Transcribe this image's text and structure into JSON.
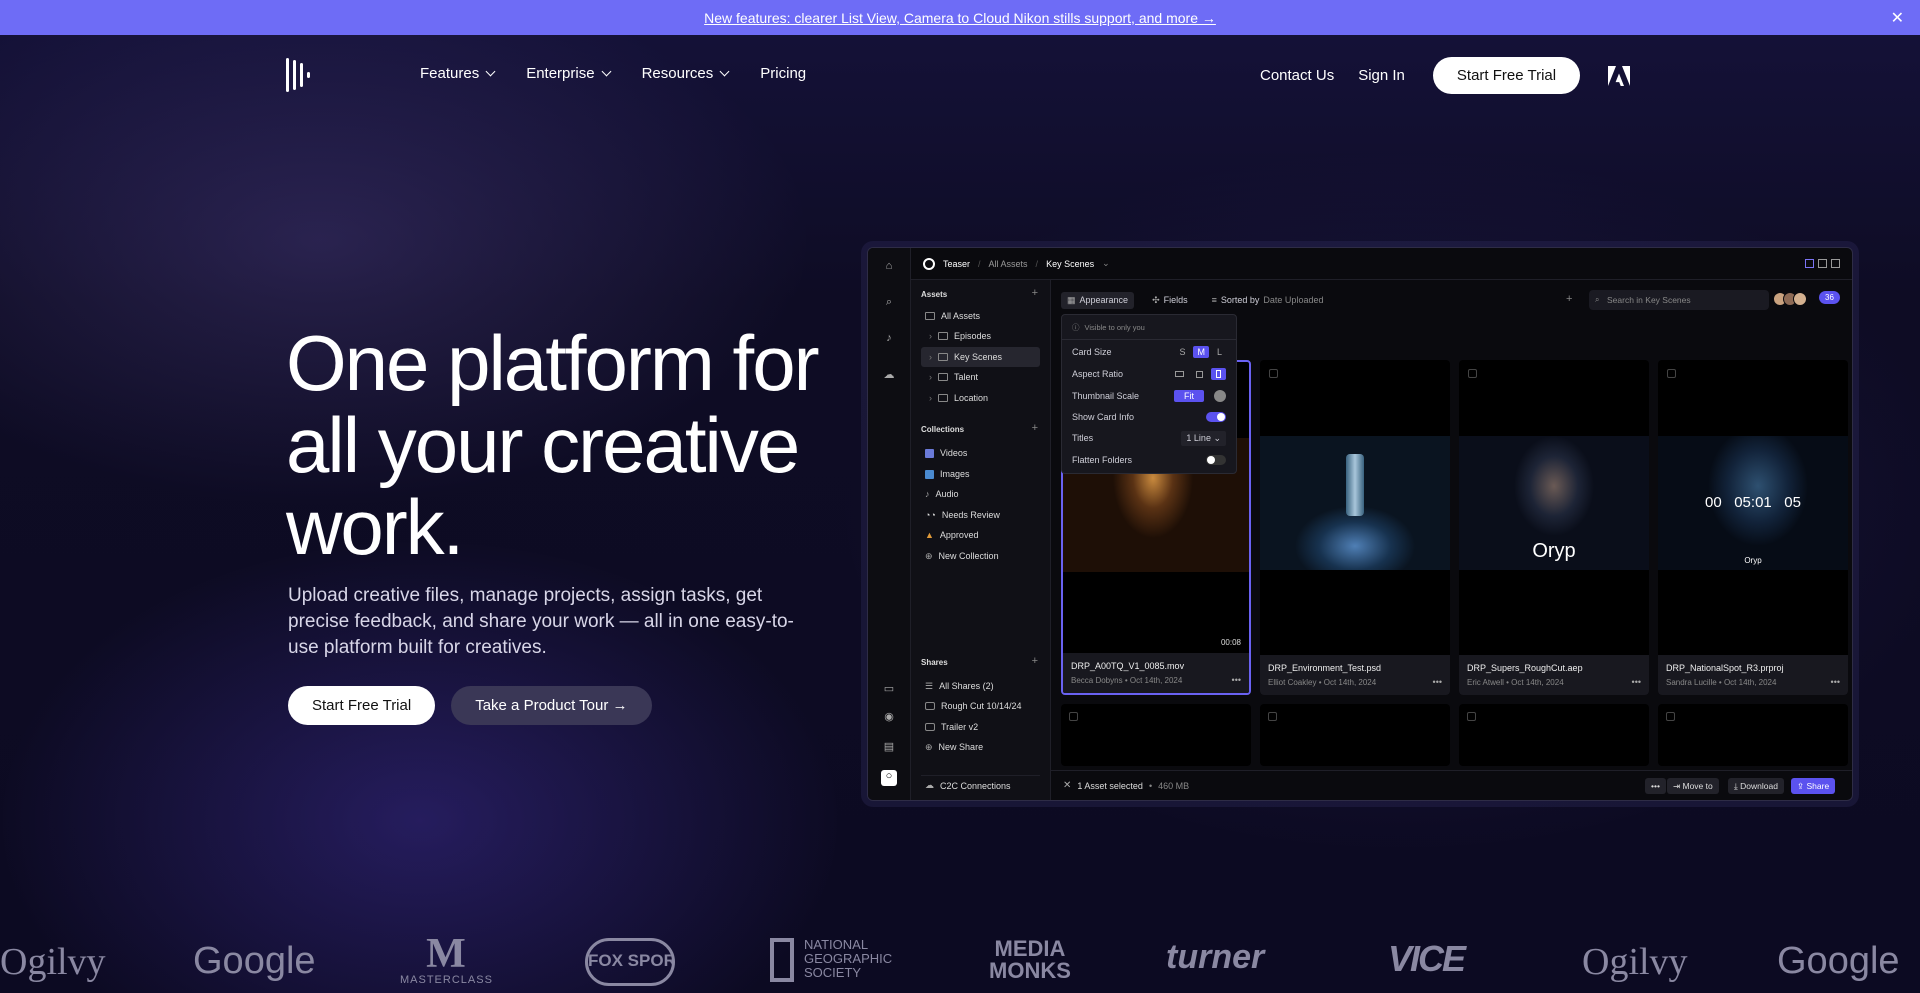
{
  "banner": {
    "text": "New features: clearer List View, Camera to Cloud Nikon stills support, and more →",
    "close": "✕"
  },
  "nav": {
    "items": [
      {
        "label": "Features"
      },
      {
        "label": "Enterprise"
      },
      {
        "label": "Resources"
      },
      {
        "label": "Pricing"
      }
    ],
    "contact": "Contact Us",
    "signin": "Sign In",
    "cta": "Start Free Trial"
  },
  "hero": {
    "title": "One platform for all your creative work.",
    "subtitle": "Upload creative files, manage projects, assign tasks, get precise feedback, and share your work — all in one easy-to-use platform built for creatives.",
    "primary": "Start Free Trial",
    "secondary": "Take a Product Tour →"
  },
  "app": {
    "breadcrumb": {
      "project": "Teaser",
      "all": "All Assets",
      "current": "Key Scenes"
    },
    "sidebar": {
      "assets_head": "Assets",
      "assets": [
        "All Assets",
        "Episodes",
        "Key Scenes",
        "Talent",
        "Location"
      ],
      "collections_head": "Collections",
      "collections": [
        "Videos",
        "Images",
        "Audio",
        "Needs Review",
        "Approved",
        "New Collection"
      ],
      "shares_head": "Shares",
      "shares": [
        "All Shares (2)",
        "Rough Cut 10/14/24",
        "Trailer v2",
        "New Share"
      ],
      "c2c": "C2C Connections"
    },
    "toolbar": {
      "appearance": "Appearance",
      "fields": "Fields",
      "sorted_by": "Sorted by",
      "sort_value": "Date Uploaded",
      "search_placeholder": "Search in Key Scenes",
      "count": "36"
    },
    "panel": {
      "visible": "Visible to only you",
      "card_size": "Card Size",
      "sizes": [
        "S",
        "M",
        "L"
      ],
      "aspect": "Aspect Ratio",
      "thumb_scale": "Thumbnail Scale",
      "fit": "Fit",
      "show_info": "Show Card Info",
      "titles": "Titles",
      "titles_value": "1 Line",
      "flatten": "Flatten Folders"
    },
    "cards": [
      {
        "name": "DRP_A00TQ_V1_0085.mov",
        "author": "Becca Dobyns",
        "date": "Oct 14th, 2024",
        "duration": "00:08"
      },
      {
        "name": "DRP_Environment_Test.psd",
        "author": "Elliot Coakley",
        "date": "Oct 14th, 2024"
      },
      {
        "name": "DRP_Supers_RoughCut.aep",
        "author": "Eric Atwell",
        "date": "Oct 14th, 2024",
        "overlay": "Oryp"
      },
      {
        "name": "DRP_NationalSpot_R3.prproj",
        "author": "Sandra Lucille",
        "date": "Oct 14th, 2024",
        "overlay": "00   05:01   05",
        "small": "Oryp"
      }
    ],
    "bottom": {
      "selected": "1 Asset selected",
      "size": "460 MB",
      "more": "•••",
      "move": "Move to",
      "download": "Download",
      "share": "Share"
    }
  },
  "logos": [
    "Ogilvy",
    "Google",
    "MASTERCLASS",
    "FOX SPORTS",
    "NATIONAL GEOGRAPHIC SOCIETY",
    "MEDIA MONKS",
    "turner",
    "VICE",
    "Ogilvy",
    "Google"
  ]
}
